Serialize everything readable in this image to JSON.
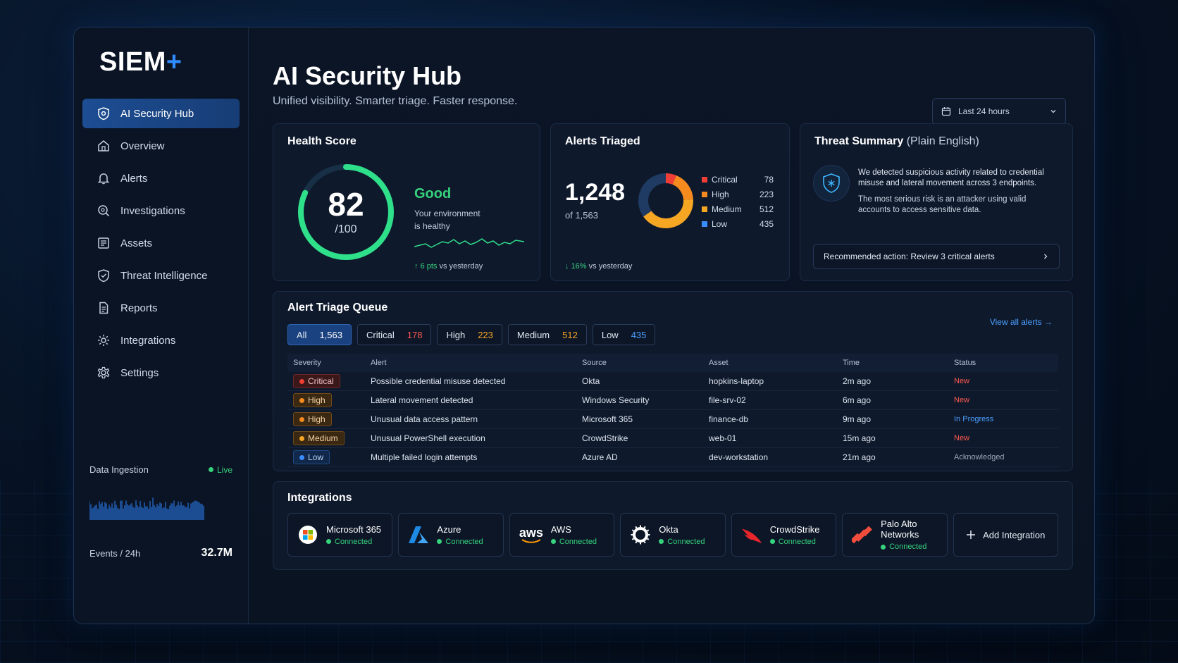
{
  "app": {
    "logo": "SIEM",
    "logo_plus": "+"
  },
  "sidebar": {
    "items": [
      {
        "label": "AI Security Hub",
        "icon": "hub-shield-icon",
        "active": true
      },
      {
        "label": "Overview",
        "icon": "home-icon"
      },
      {
        "label": "Alerts",
        "icon": "bell-icon"
      },
      {
        "label": "Investigations",
        "icon": "magnifier-icon"
      },
      {
        "label": "Assets",
        "icon": "list-icon"
      },
      {
        "label": "Threat Intelligence",
        "icon": "shield-icon"
      },
      {
        "label": "Reports",
        "icon": "document-icon"
      },
      {
        "label": "Integrations",
        "icon": "gear-link-icon"
      },
      {
        "label": "Settings",
        "icon": "gear-icon"
      }
    ],
    "ingestion": {
      "label": "Data Ingestion",
      "live": "Live",
      "events_label": "Events / 24h",
      "events_value": "32.7M"
    }
  },
  "header": {
    "title": "AI Security Hub",
    "subtitle": "Unified visibility. Smarter triage. Faster response.",
    "range": "Last 24 hours"
  },
  "health": {
    "title": "Health Score",
    "score": "82",
    "max": "/100",
    "score_value": 82,
    "status": "Good",
    "desc_line1": "Your environment",
    "desc_line2": "is healthy",
    "delta_value": "6 pts",
    "delta_text": "vs yesterday"
  },
  "alerts_triaged": {
    "title": "Alerts Triaged",
    "count": "1,248",
    "of": "of 1,563",
    "delta_value": "16%",
    "delta_text": "vs yesterday",
    "breakdown": [
      {
        "name": "Critical",
        "count": "78",
        "value": 78,
        "color": "#ef3e36"
      },
      {
        "name": "High",
        "count": "223",
        "value": 223,
        "color": "#f58a1f"
      },
      {
        "name": "Medium",
        "count": "512",
        "value": 512,
        "color": "#f5a623"
      },
      {
        "name": "Low",
        "count": "435",
        "value": 435,
        "color": "#1f3b63"
      }
    ]
  },
  "threat_summary": {
    "title": "Threat Summary",
    "title_suffix": "(Plain English)",
    "para1": "We detected suspicious activity related to credential misuse and lateral movement across 3 endpoints.",
    "para2": "The most serious risk is an attacker using valid accounts to access sensitive data.",
    "action": "Recommended action: Review 3 critical alerts"
  },
  "queue": {
    "title": "Alert Triage Queue",
    "view_all": "View all alerts",
    "chips": [
      {
        "label": "All",
        "count": "1,563",
        "color": "#ffffff",
        "active": true
      },
      {
        "label": "Critical",
        "count": "178",
        "color": "#ff5a4e"
      },
      {
        "label": "High",
        "count": "223",
        "color": "#f5a623"
      },
      {
        "label": "Medium",
        "count": "512",
        "color": "#f5a623"
      },
      {
        "label": "Low",
        "count": "435",
        "color": "#4ca0ff"
      }
    ],
    "columns": [
      "Severity",
      "Alert",
      "Source",
      "Asset",
      "Time",
      "Status"
    ],
    "rows": [
      {
        "severity": "Critical",
        "sev_class": "critical",
        "dot": "#ef3e36",
        "alert": "Possible credential misuse detected",
        "source": "Okta",
        "asset": "hopkins-laptop",
        "time": "2m ago",
        "status": "New",
        "status_class": "st-new"
      },
      {
        "severity": "High",
        "sev_class": "high",
        "dot": "#f58a1f",
        "alert": "Lateral movement detected",
        "source": "Windows Security",
        "asset": "file-srv-02",
        "time": "6m ago",
        "status": "New",
        "status_class": "st-new"
      },
      {
        "severity": "High",
        "sev_class": "high",
        "dot": "#f58a1f",
        "alert": "Unusual data access pattern",
        "source": "Microsoft 365",
        "asset": "finance-db",
        "time": "9m ago",
        "status": "In Progress",
        "status_class": "st-prog"
      },
      {
        "severity": "Medium",
        "sev_class": "medium",
        "dot": "#f5a623",
        "alert": "Unusual PowerShell execution",
        "source": "CrowdStrike",
        "asset": "web-01",
        "time": "15m ago",
        "status": "New",
        "status_class": "st-new"
      },
      {
        "severity": "Low",
        "sev_class": "low",
        "dot": "#3a8dff",
        "alert": "Multiple failed login attempts",
        "source": "Azure AD",
        "asset": "dev-workstation",
        "time": "21m ago",
        "status": "Acknowledged",
        "status_class": "st-ack"
      }
    ]
  },
  "integrations": {
    "title": "Integrations",
    "items": [
      {
        "name": "Microsoft 365",
        "status": "Connected",
        "icon": "microsoft-icon"
      },
      {
        "name": "Azure",
        "status": "Connected",
        "icon": "azure-icon"
      },
      {
        "name": "AWS",
        "status": "Connected",
        "icon": "aws-icon",
        "icon_text": "aws"
      },
      {
        "name": "Okta",
        "status": "Connected",
        "icon": "okta-icon"
      },
      {
        "name": "CrowdStrike",
        "status": "Connected",
        "icon": "crowdstrike-icon"
      },
      {
        "name": "Palo Alto Networks",
        "status": "Connected",
        "icon": "paloalto-icon"
      }
    ],
    "add_label": "Add Integration"
  }
}
